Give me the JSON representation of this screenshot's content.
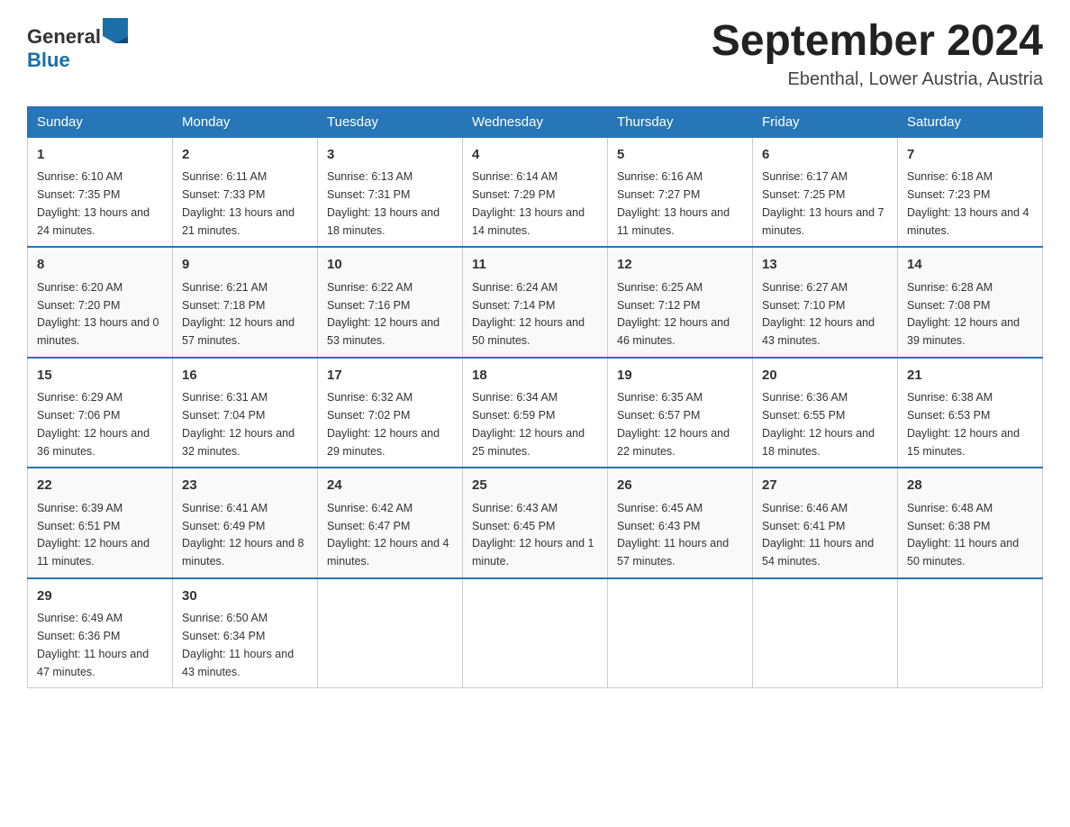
{
  "header": {
    "logo_general": "General",
    "logo_blue": "Blue",
    "month_title": "September 2024",
    "location": "Ebenthal, Lower Austria, Austria"
  },
  "weekdays": [
    "Sunday",
    "Monday",
    "Tuesday",
    "Wednesday",
    "Thursday",
    "Friday",
    "Saturday"
  ],
  "weeks": [
    [
      {
        "day": "1",
        "sunrise": "Sunrise: 6:10 AM",
        "sunset": "Sunset: 7:35 PM",
        "daylight": "Daylight: 13 hours and 24 minutes."
      },
      {
        "day": "2",
        "sunrise": "Sunrise: 6:11 AM",
        "sunset": "Sunset: 7:33 PM",
        "daylight": "Daylight: 13 hours and 21 minutes."
      },
      {
        "day": "3",
        "sunrise": "Sunrise: 6:13 AM",
        "sunset": "Sunset: 7:31 PM",
        "daylight": "Daylight: 13 hours and 18 minutes."
      },
      {
        "day": "4",
        "sunrise": "Sunrise: 6:14 AM",
        "sunset": "Sunset: 7:29 PM",
        "daylight": "Daylight: 13 hours and 14 minutes."
      },
      {
        "day": "5",
        "sunrise": "Sunrise: 6:16 AM",
        "sunset": "Sunset: 7:27 PM",
        "daylight": "Daylight: 13 hours and 11 minutes."
      },
      {
        "day": "6",
        "sunrise": "Sunrise: 6:17 AM",
        "sunset": "Sunset: 7:25 PM",
        "daylight": "Daylight: 13 hours and 7 minutes."
      },
      {
        "day": "7",
        "sunrise": "Sunrise: 6:18 AM",
        "sunset": "Sunset: 7:23 PM",
        "daylight": "Daylight: 13 hours and 4 minutes."
      }
    ],
    [
      {
        "day": "8",
        "sunrise": "Sunrise: 6:20 AM",
        "sunset": "Sunset: 7:20 PM",
        "daylight": "Daylight: 13 hours and 0 minutes."
      },
      {
        "day": "9",
        "sunrise": "Sunrise: 6:21 AM",
        "sunset": "Sunset: 7:18 PM",
        "daylight": "Daylight: 12 hours and 57 minutes."
      },
      {
        "day": "10",
        "sunrise": "Sunrise: 6:22 AM",
        "sunset": "Sunset: 7:16 PM",
        "daylight": "Daylight: 12 hours and 53 minutes."
      },
      {
        "day": "11",
        "sunrise": "Sunrise: 6:24 AM",
        "sunset": "Sunset: 7:14 PM",
        "daylight": "Daylight: 12 hours and 50 minutes."
      },
      {
        "day": "12",
        "sunrise": "Sunrise: 6:25 AM",
        "sunset": "Sunset: 7:12 PM",
        "daylight": "Daylight: 12 hours and 46 minutes."
      },
      {
        "day": "13",
        "sunrise": "Sunrise: 6:27 AM",
        "sunset": "Sunset: 7:10 PM",
        "daylight": "Daylight: 12 hours and 43 minutes."
      },
      {
        "day": "14",
        "sunrise": "Sunrise: 6:28 AM",
        "sunset": "Sunset: 7:08 PM",
        "daylight": "Daylight: 12 hours and 39 minutes."
      }
    ],
    [
      {
        "day": "15",
        "sunrise": "Sunrise: 6:29 AM",
        "sunset": "Sunset: 7:06 PM",
        "daylight": "Daylight: 12 hours and 36 minutes."
      },
      {
        "day": "16",
        "sunrise": "Sunrise: 6:31 AM",
        "sunset": "Sunset: 7:04 PM",
        "daylight": "Daylight: 12 hours and 32 minutes."
      },
      {
        "day": "17",
        "sunrise": "Sunrise: 6:32 AM",
        "sunset": "Sunset: 7:02 PM",
        "daylight": "Daylight: 12 hours and 29 minutes."
      },
      {
        "day": "18",
        "sunrise": "Sunrise: 6:34 AM",
        "sunset": "Sunset: 6:59 PM",
        "daylight": "Daylight: 12 hours and 25 minutes."
      },
      {
        "day": "19",
        "sunrise": "Sunrise: 6:35 AM",
        "sunset": "Sunset: 6:57 PM",
        "daylight": "Daylight: 12 hours and 22 minutes."
      },
      {
        "day": "20",
        "sunrise": "Sunrise: 6:36 AM",
        "sunset": "Sunset: 6:55 PM",
        "daylight": "Daylight: 12 hours and 18 minutes."
      },
      {
        "day": "21",
        "sunrise": "Sunrise: 6:38 AM",
        "sunset": "Sunset: 6:53 PM",
        "daylight": "Daylight: 12 hours and 15 minutes."
      }
    ],
    [
      {
        "day": "22",
        "sunrise": "Sunrise: 6:39 AM",
        "sunset": "Sunset: 6:51 PM",
        "daylight": "Daylight: 12 hours and 11 minutes."
      },
      {
        "day": "23",
        "sunrise": "Sunrise: 6:41 AM",
        "sunset": "Sunset: 6:49 PM",
        "daylight": "Daylight: 12 hours and 8 minutes."
      },
      {
        "day": "24",
        "sunrise": "Sunrise: 6:42 AM",
        "sunset": "Sunset: 6:47 PM",
        "daylight": "Daylight: 12 hours and 4 minutes."
      },
      {
        "day": "25",
        "sunrise": "Sunrise: 6:43 AM",
        "sunset": "Sunset: 6:45 PM",
        "daylight": "Daylight: 12 hours and 1 minute."
      },
      {
        "day": "26",
        "sunrise": "Sunrise: 6:45 AM",
        "sunset": "Sunset: 6:43 PM",
        "daylight": "Daylight: 11 hours and 57 minutes."
      },
      {
        "day": "27",
        "sunrise": "Sunrise: 6:46 AM",
        "sunset": "Sunset: 6:41 PM",
        "daylight": "Daylight: 11 hours and 54 minutes."
      },
      {
        "day": "28",
        "sunrise": "Sunrise: 6:48 AM",
        "sunset": "Sunset: 6:38 PM",
        "daylight": "Daylight: 11 hours and 50 minutes."
      }
    ],
    [
      {
        "day": "29",
        "sunrise": "Sunrise: 6:49 AM",
        "sunset": "Sunset: 6:36 PM",
        "daylight": "Daylight: 11 hours and 47 minutes."
      },
      {
        "day": "30",
        "sunrise": "Sunrise: 6:50 AM",
        "sunset": "Sunset: 6:34 PM",
        "daylight": "Daylight: 11 hours and 43 minutes."
      },
      null,
      null,
      null,
      null,
      null
    ]
  ]
}
